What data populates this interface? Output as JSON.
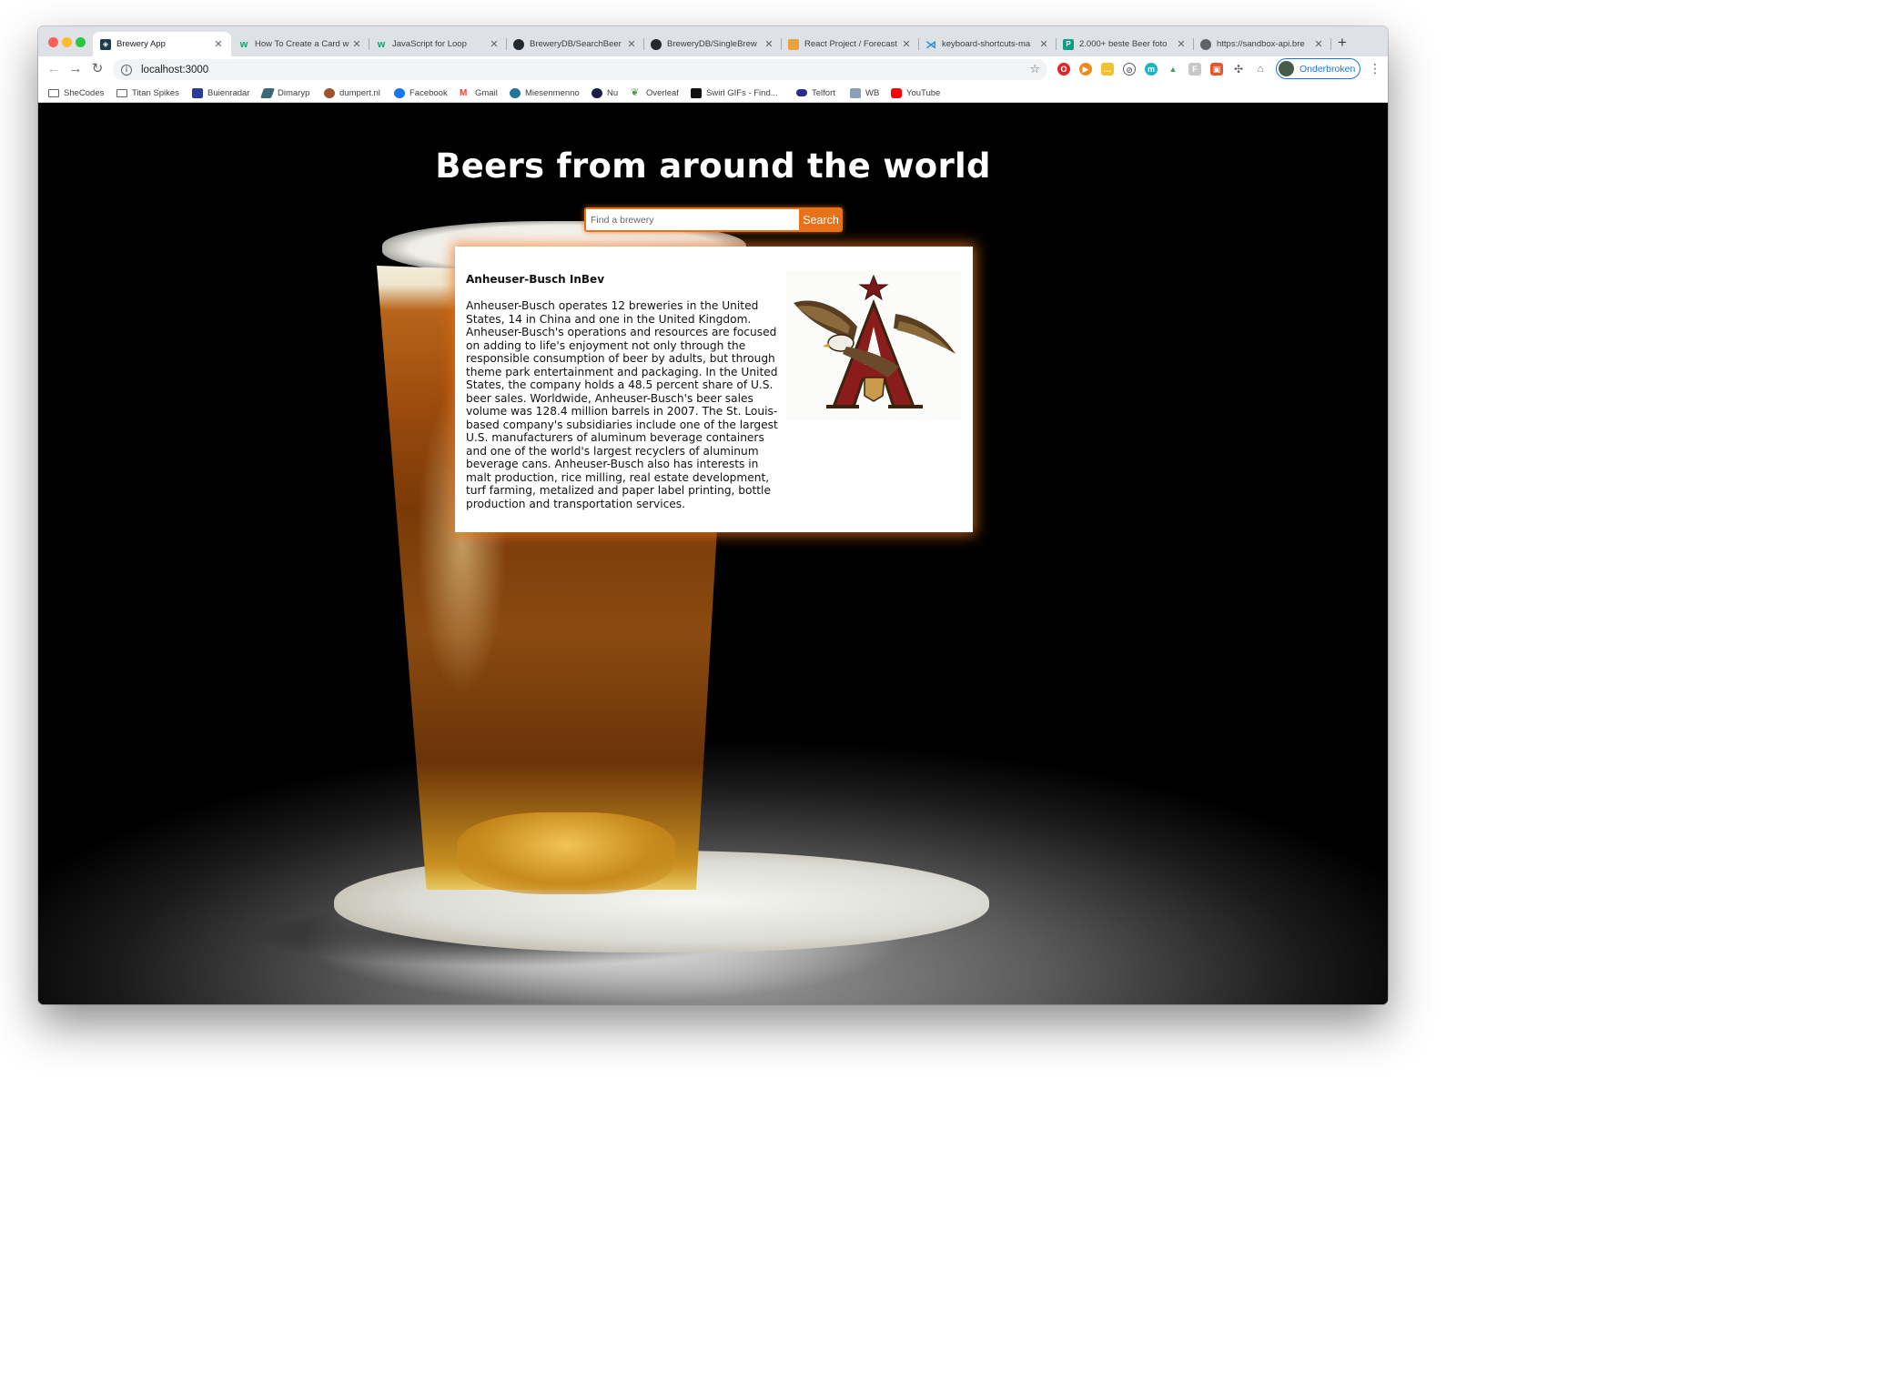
{
  "browser": {
    "tabs": [
      {
        "label": "Brewery App",
        "icon": "brewery-app-favicon",
        "color": "#1e3d4a",
        "active": true
      },
      {
        "label": "How To Create a Card w",
        "icon": "w3schools-favicon",
        "color": "#04aa6d"
      },
      {
        "label": "JavaScript for Loop",
        "icon": "w3schools-favicon",
        "color": "#04aa6d"
      },
      {
        "label": "BreweryDB/SearchBeer",
        "icon": "github-favicon",
        "color": "#24292f"
      },
      {
        "label": "BreweryDB/SingleBrew",
        "icon": "github-favicon",
        "color": "#24292f"
      },
      {
        "label": "React Project / Forecast",
        "icon": "shecodes-favicon",
        "color": "#e8a33d"
      },
      {
        "label": "keyboard-shortcuts-ma",
        "icon": "vscode-favicon",
        "color": "#1f8ad2"
      },
      {
        "label": "2.000+ beste Beer foto",
        "icon": "pexels-favicon",
        "color": "#05a081"
      },
      {
        "label": "https://sandbox-api.bre",
        "icon": "globe-favicon",
        "color": "#5f6368"
      }
    ],
    "url": "localhost:3000",
    "profile_label": "Onderbroken",
    "bookmarks": [
      {
        "label": "SheCodes",
        "icon": "folder-icon"
      },
      {
        "label": "Titan Spikes",
        "icon": "folder-icon"
      },
      {
        "label": "Buienradar",
        "icon": "buienradar-icon",
        "color": "#2b3b9b"
      },
      {
        "label": "Dimaryp",
        "icon": "dimaryp-icon",
        "color": "#3a6a7a"
      },
      {
        "label": "dumpert.nl",
        "icon": "dumpert-icon",
        "color": "#a0522d"
      },
      {
        "label": "Facebook",
        "icon": "facebook-icon",
        "color": "#1877f2"
      },
      {
        "label": "Gmail",
        "icon": "gmail-icon",
        "color": "#ea4335"
      },
      {
        "label": "Miesenmenno",
        "icon": "wordpress-icon",
        "color": "#21759b"
      },
      {
        "label": "Nu",
        "icon": "nu-icon",
        "color": "#1a1a4a"
      },
      {
        "label": "Overleaf",
        "icon": "overleaf-icon",
        "color": "#47a141"
      },
      {
        "label": "Swirl GIFs - Find...",
        "icon": "giphy-icon",
        "color": "#111111"
      },
      {
        "label": "Telfort",
        "icon": "telfort-icon",
        "color": "#2a2a8a"
      },
      {
        "label": "WB",
        "icon": "wb-icon",
        "color": "#8aa0b8"
      },
      {
        "label": "YouTube",
        "icon": "youtube-icon",
        "color": "#ff0000"
      }
    ]
  },
  "page": {
    "title": "Beers from around the world",
    "search": {
      "placeholder": "Find a brewery",
      "button_label": "Search"
    },
    "card": {
      "name": "Anheuser-Busch InBev",
      "description": "Anheuser-Busch operates 12 breweries in the United States, 14 in China and one in the United Kingdom. Anheuser-Busch's operations and resources are focused on adding to life's enjoyment not only through the responsible consumption of beer by adults, but through theme park entertainment and packaging. In the United States, the company holds a 48.5 percent share of U.S. beer sales. Worldwide, Anheuser-Busch's beer sales volume was 128.4 million barrels in 2007. The St. Louis-based company's subsidiaries include one of the largest U.S. manufacturers of aluminum beverage containers and one of the world's largest recyclers of aluminum beverage cans. Anheuser-Busch also has interests in malt production, rice milling, real estate development, turf farming, metalized and paper label printing, bottle production and transportation services.",
      "logo": "anheuser-busch-eagle-logo"
    },
    "accent_color": "#e8721a"
  }
}
